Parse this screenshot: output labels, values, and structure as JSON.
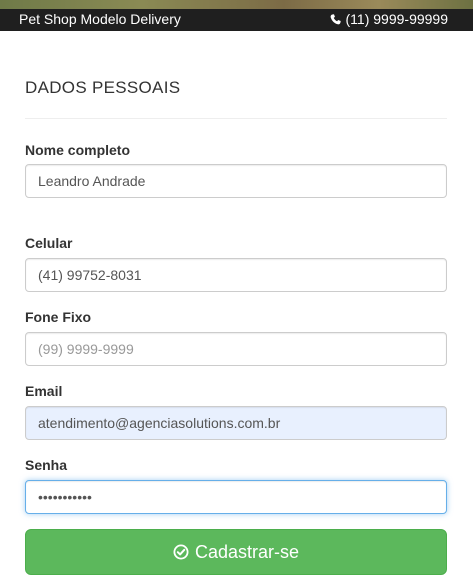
{
  "header": {
    "shop_name": "Pet Shop Modelo Delivery",
    "phone": "(11) 9999-99999",
    "phone_icon": "phone-icon"
  },
  "form": {
    "section_title": "DADOS PESSOAIS",
    "name": {
      "label": "Nome completo",
      "value": "Leandro Andrade",
      "placeholder": ""
    },
    "mobile": {
      "label": "Celular",
      "value": "(41) 99752-8031",
      "placeholder": ""
    },
    "landline": {
      "label": "Fone Fixo",
      "value": "",
      "placeholder": "(99) 9999-9999"
    },
    "email": {
      "label": "Email",
      "value": "atendimento@agenciasolutions.com.br",
      "placeholder": ""
    },
    "password": {
      "label": "Senha",
      "value": "•••••••••••",
      "placeholder": ""
    },
    "submit_label": "Cadastrar-se",
    "submit_icon": "check-circle-icon"
  },
  "colors": {
    "topbar": "#1f1f1f",
    "submit": "#5cb85c",
    "autofill": "#e8f0fe",
    "focus_border": "#66afe9"
  }
}
